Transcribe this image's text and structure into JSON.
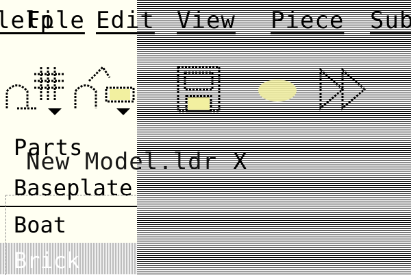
{
  "menubar": {
    "items": [
      "lelp",
      "File",
      "Edit",
      "View",
      "Piece",
      "Sub"
    ]
  },
  "toolbar": {
    "icons": [
      "new-model-icon",
      "open-model-icon",
      "mesh-icon",
      "save-icon",
      "render-icon",
      "forward-icon"
    ]
  },
  "parts_panel": {
    "title": "Parts",
    "items": [
      "Baseplate",
      "Boat",
      "Brick"
    ],
    "selected_index": 2
  },
  "document_tab": {
    "label": "New Model.ldr",
    "close_symbol": "X"
  },
  "colors": {
    "left_background": "#fffff2",
    "selection_gray": "#bdbdbd",
    "icon_yellow": "#f2f0a0"
  }
}
